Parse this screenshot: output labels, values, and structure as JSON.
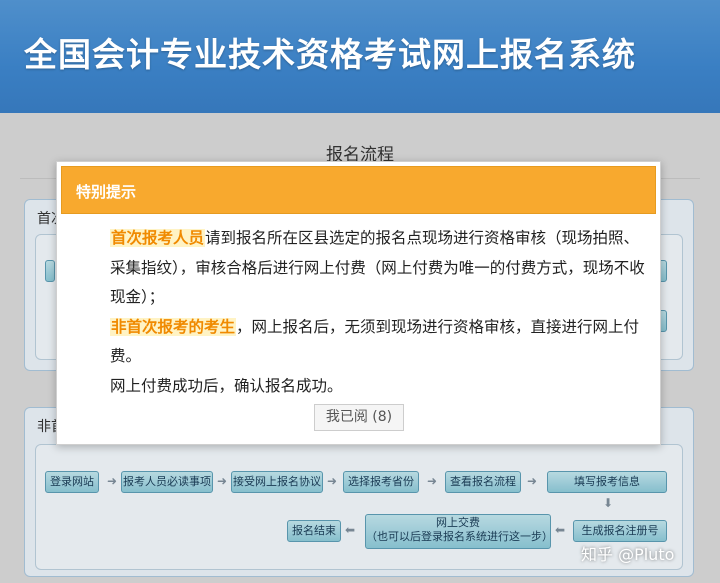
{
  "header": {
    "title": "全国会计专业技术资格考试网上报名系统"
  },
  "page": {
    "title": "报名流程"
  },
  "first_panel": {
    "title": "首次"
  },
  "nonfirst_panel": {
    "title": "非首",
    "row1": [
      "登录网站",
      "报考人员必读事项",
      "接受网上报名协议",
      "选择报考省份",
      "查看报名流程",
      "填写报考信息"
    ],
    "row2_end": "报名结束",
    "row2_pay_line1": "网上交费",
    "row2_pay_line2": "（也可以后登录报名系统进行这一步）",
    "row2_gen": "生成报名注册号"
  },
  "modal": {
    "title": "特别提示",
    "p1_highlight": "首次报考人员",
    "p1_text": "请到报名所在区县选定的报名点现场进行资格审核（现场拍照、采集指纹），审核合格后进行网上付费（网上付费为唯一的付费方式，现场不收现金）；",
    "p2_highlight": "非首次报考的考生",
    "p2_text": "，网上报名后，无须到现场进行资格审核，直接进行网上付费。",
    "p3_text": "网上付费成功后，确认报名成功。",
    "ok_label": "我已阅 (8)"
  },
  "watermark": "知乎 @Pluto"
}
